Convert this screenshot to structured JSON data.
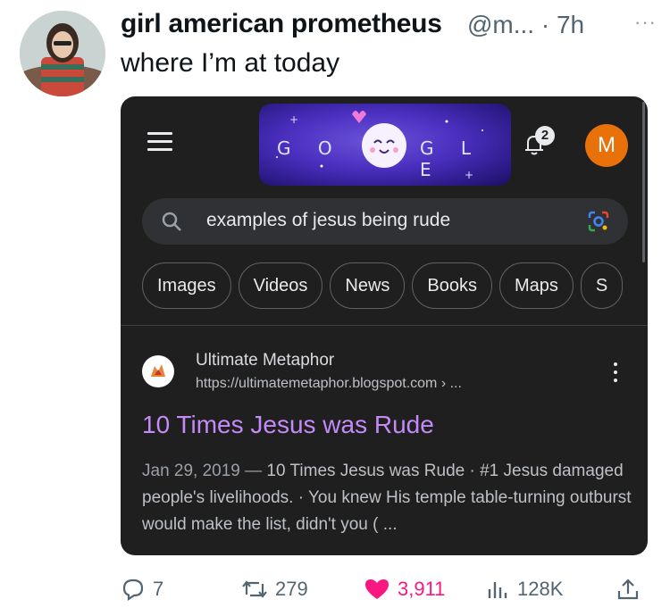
{
  "tweet": {
    "author_name": "girl american prometheus",
    "handle": "@m...",
    "time": "· 7h",
    "more": "···",
    "text": "where I’m at today"
  },
  "screenshot": {
    "doodle_letters_left": "G O",
    "doodle_letters_right": "G L E",
    "notification_count": "2",
    "profile_initial": "M",
    "search_query": "examples of jesus being rude",
    "tabs": [
      "Images",
      "Videos",
      "News",
      "Books",
      "Maps",
      "S"
    ],
    "result": {
      "site_name": "Ultimate Metaphor",
      "url": "https://ultimatemetaphor.blogspot.com › ...",
      "title": "10 Times Jesus was Rude",
      "date": "Jan 29, 2019 —",
      "snippet": " 10 Times Jesus was Rude · #1 Jesus damaged people's livelihoods. · You knew His temple table-turning outburst would make the list, didn't you ( ..."
    }
  },
  "actions": {
    "replies": "7",
    "retweets": "279",
    "likes": "3,911",
    "views": "128K"
  },
  "colors": {
    "like": "#f91880",
    "link_title": "#c58af9",
    "profile_bg": "#e8710a"
  }
}
